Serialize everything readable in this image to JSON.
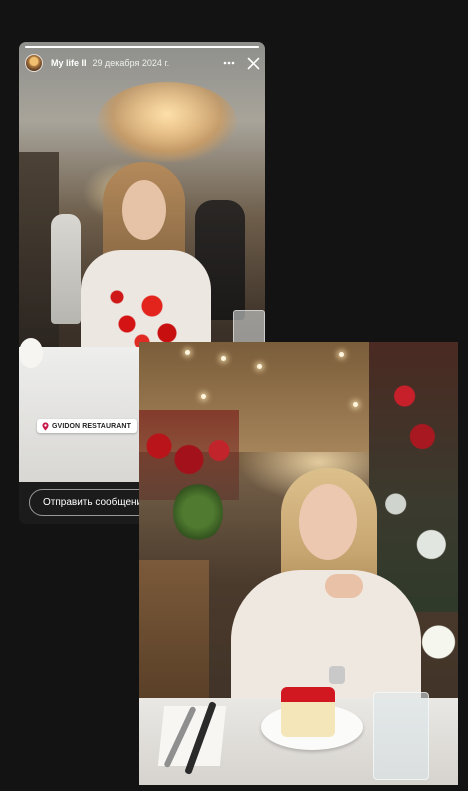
{
  "story": {
    "username": "My life II",
    "date": "29 декабря 2024 г.",
    "progress": 1.0,
    "location": "GVIDON RESTAURANT",
    "reply_placeholder": "Отправить сообщение"
  },
  "icons": {
    "more": "more-horizontal-icon",
    "close": "close-icon",
    "location_pin": "location-pin-icon"
  },
  "colors": {
    "background": "#131313",
    "flowers_red": "#d41414"
  }
}
